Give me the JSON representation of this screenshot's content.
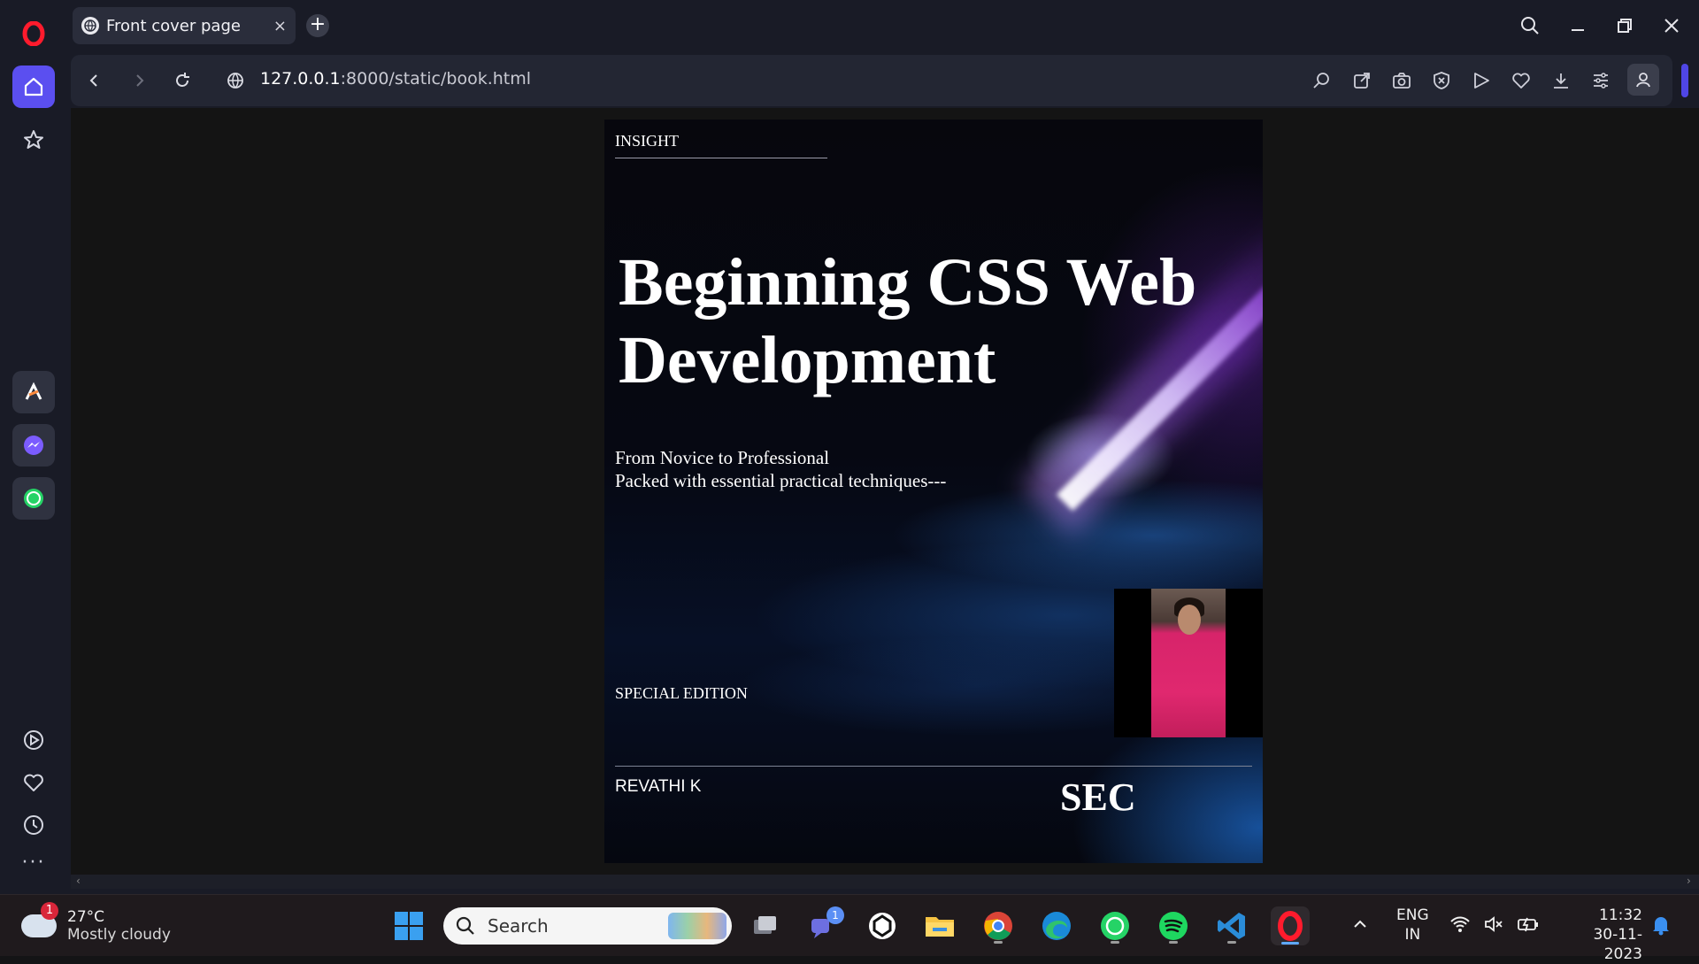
{
  "browser": {
    "tab": {
      "title": "Front cover page",
      "close": "×"
    },
    "new_tab": "+",
    "address": {
      "host": "127.0.0.1",
      "rest": ":8000/static/book.html"
    }
  },
  "sidebar": {
    "more": "···"
  },
  "cover": {
    "publisher": "INSIGHT",
    "title": "Beginning CSS Web Development",
    "subtitle_line1": "From Novice to Professional",
    "subtitle_line2": "Packed with essential practical techniques---",
    "edition": "SPECIAL EDITION",
    "author": "REVATHI K",
    "logo": "SEC"
  },
  "taskbar": {
    "weather": {
      "badge": "1",
      "temp": "27°C",
      "condition": "Mostly cloudy"
    },
    "search_placeholder": "Search",
    "teams_badge": "1",
    "lang_line1": "ENG",
    "lang_line2": "IN",
    "time": "11:32",
    "date": "30-11-2023"
  },
  "colors": {
    "accent": "#5b4ff0",
    "cover_accent": "#1e6ed2",
    "title_text": "#ffffff"
  }
}
